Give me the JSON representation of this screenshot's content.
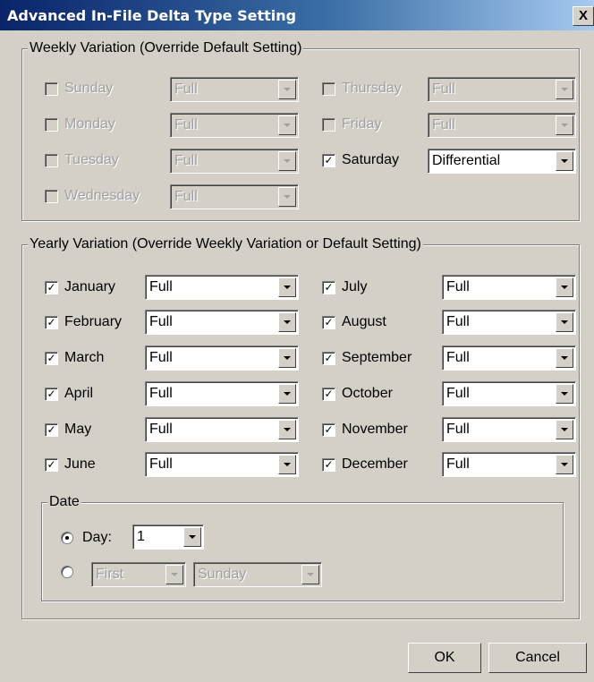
{
  "window": {
    "title": "Advanced In-File Delta Type Setting",
    "close_label": "X"
  },
  "weekly": {
    "legend": "Weekly Variation (Override Default Setting)",
    "days": [
      {
        "label": "Sunday",
        "checked": false,
        "value": "Full",
        "enabled": false
      },
      {
        "label": "Monday",
        "checked": false,
        "value": "Full",
        "enabled": false
      },
      {
        "label": "Tuesday",
        "checked": false,
        "value": "Full",
        "enabled": false
      },
      {
        "label": "Wednesday",
        "checked": false,
        "value": "Full",
        "enabled": false
      },
      {
        "label": "Thursday",
        "checked": false,
        "value": "Full",
        "enabled": false
      },
      {
        "label": "Friday",
        "checked": false,
        "value": "Full",
        "enabled": false
      },
      {
        "label": "Saturday",
        "checked": true,
        "value": "Differential",
        "enabled": true
      }
    ]
  },
  "yearly": {
    "legend": "Yearly Variation (Override Weekly Variation or Default Setting)",
    "months": [
      {
        "label": "January",
        "checked": true,
        "value": "Full"
      },
      {
        "label": "February",
        "checked": true,
        "value": "Full"
      },
      {
        "label": "March",
        "checked": true,
        "value": "Full"
      },
      {
        "label": "April",
        "checked": true,
        "value": "Full"
      },
      {
        "label": "May",
        "checked": true,
        "value": "Full"
      },
      {
        "label": "June",
        "checked": true,
        "value": "Full"
      },
      {
        "label": "July",
        "checked": true,
        "value": "Full"
      },
      {
        "label": "August",
        "checked": true,
        "value": "Full"
      },
      {
        "label": "September",
        "checked": true,
        "value": "Full"
      },
      {
        "label": "October",
        "checked": true,
        "value": "Full"
      },
      {
        "label": "November",
        "checked": true,
        "value": "Full"
      },
      {
        "label": "December",
        "checked": true,
        "value": "Full"
      }
    ],
    "date": {
      "legend": "Date",
      "day_option": {
        "label": "Day:",
        "selected": true,
        "value": "1"
      },
      "relative_option": {
        "selected": false,
        "ordinal": "First",
        "weekday": "Sunday"
      }
    }
  },
  "buttons": {
    "ok": "OK",
    "cancel": "Cancel"
  },
  "check_mark": "✓"
}
